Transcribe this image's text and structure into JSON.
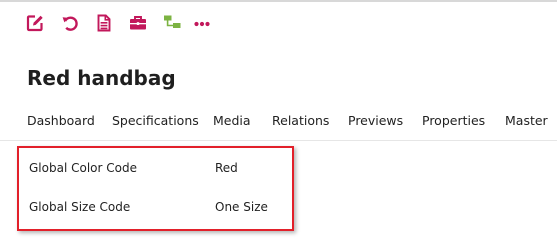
{
  "toolbar": {
    "icons": [
      "edit-icon",
      "revert-icon",
      "document-icon",
      "briefcase-icon",
      "hierarchy-icon",
      "more-icon"
    ],
    "accent_color": "#c2185b",
    "secondary_color": "#7cb342"
  },
  "page": {
    "title": "Red handbag"
  },
  "tabs": [
    {
      "label": "Dashboard"
    },
    {
      "label": "Specifications"
    },
    {
      "label": "Media"
    },
    {
      "label": "Relations"
    },
    {
      "label": "Previews"
    },
    {
      "label": "Properties"
    },
    {
      "label": "Master"
    }
  ],
  "attributes": [
    {
      "label": "Global Color Code",
      "value": "Red"
    },
    {
      "label": "Global Size Code",
      "value": "One Size"
    }
  ],
  "highlight_color": "#e2202a"
}
